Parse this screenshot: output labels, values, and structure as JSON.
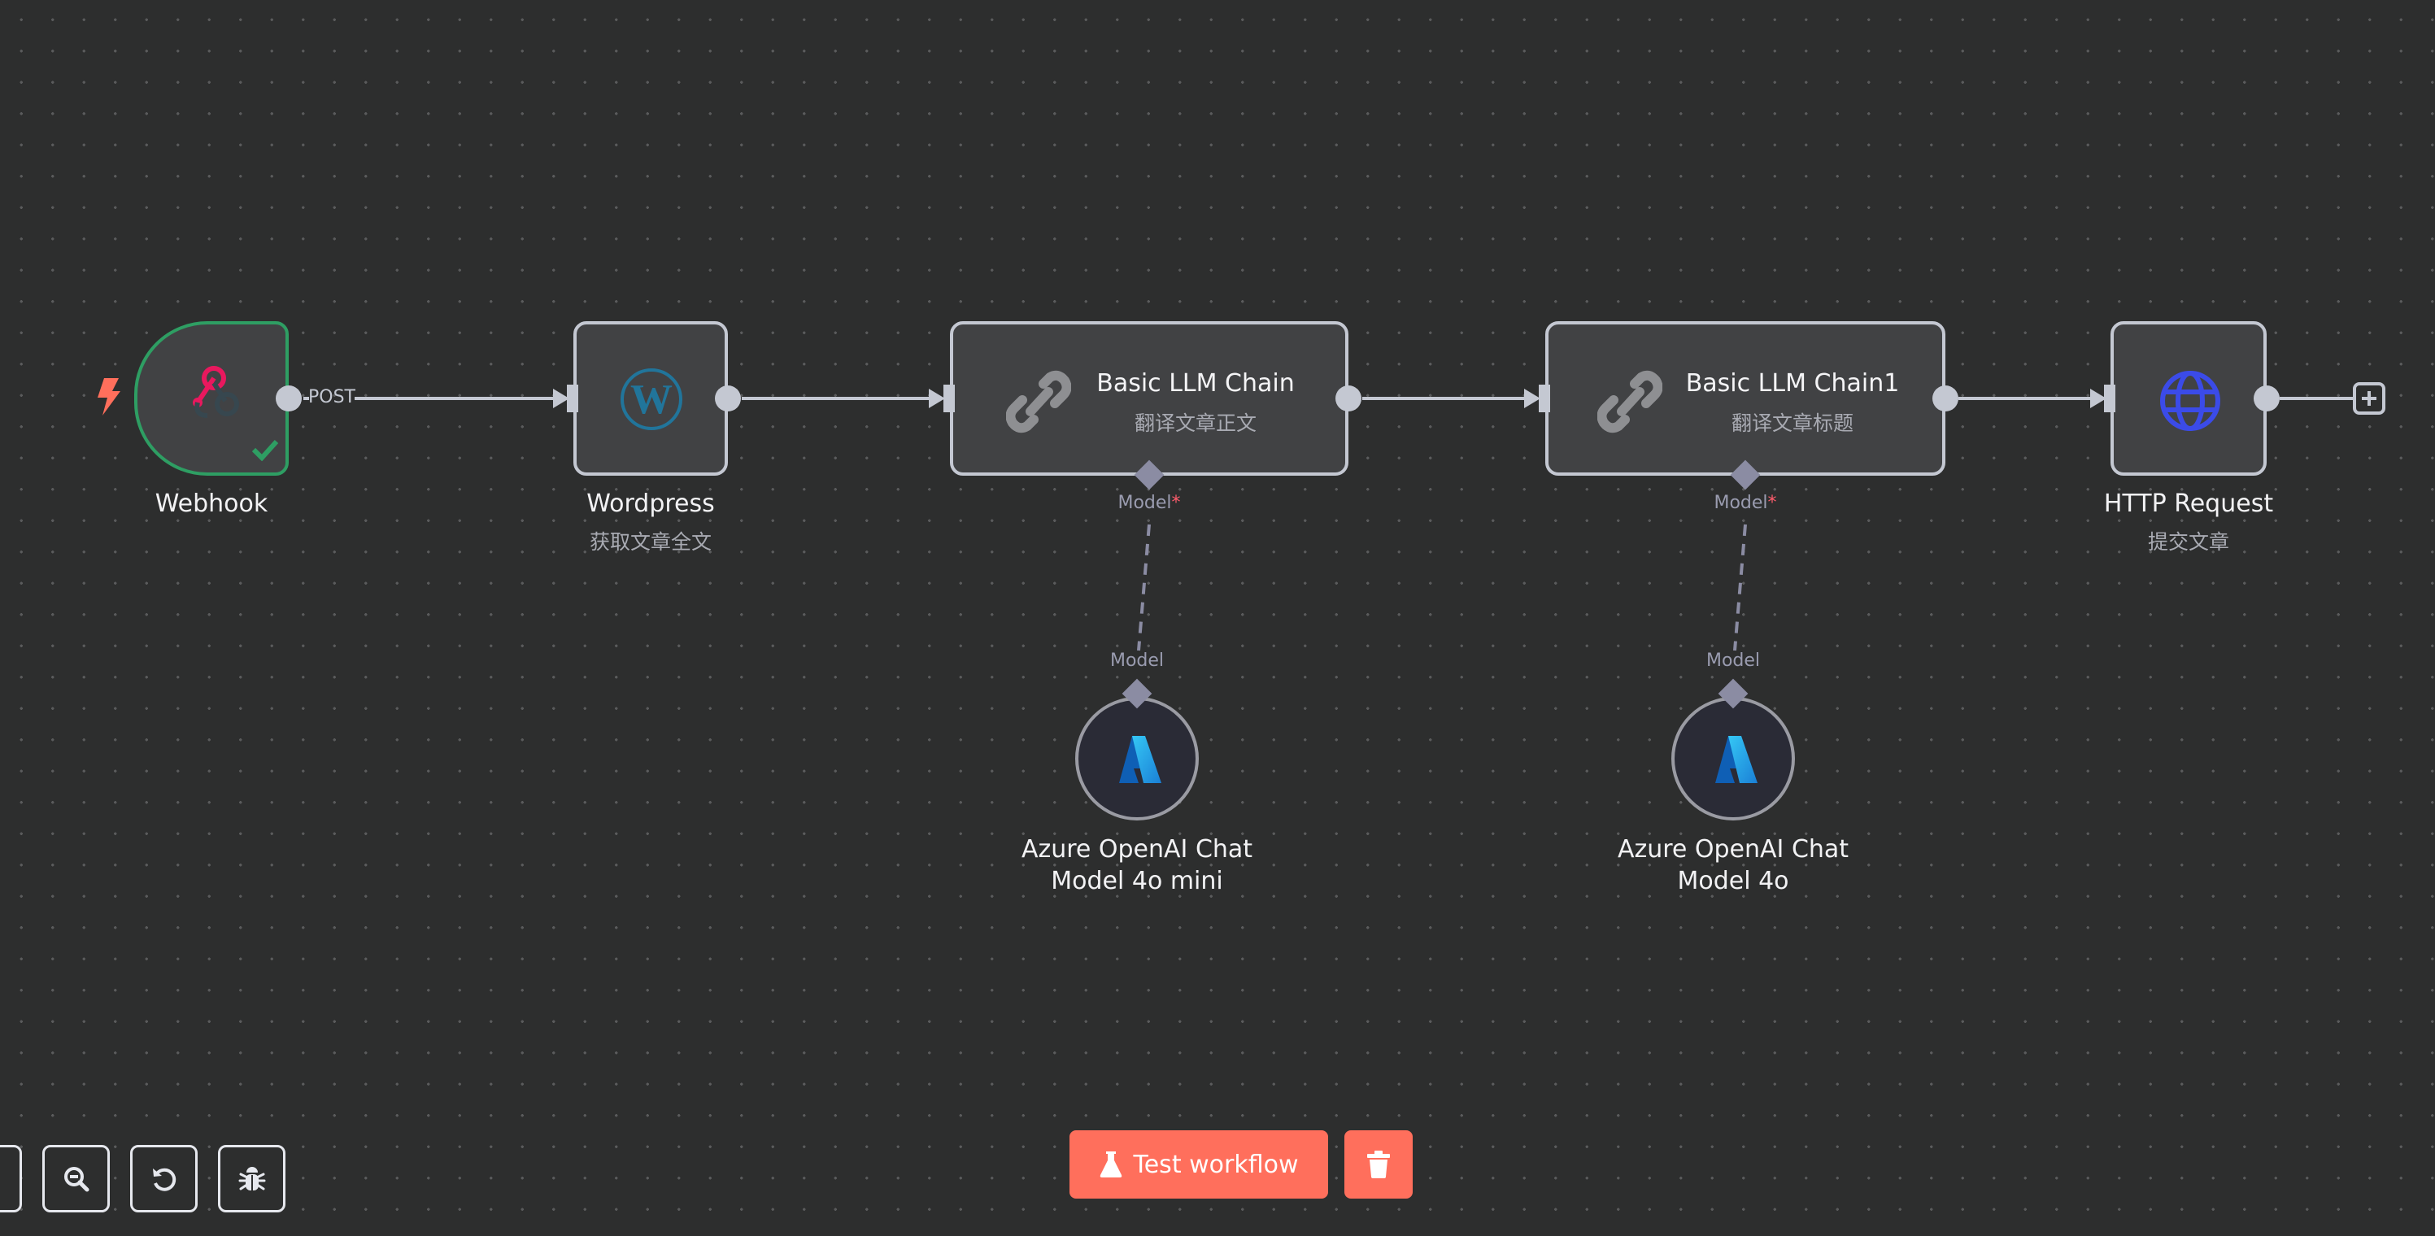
{
  "canvas": {
    "nodes": [
      {
        "id": "webhook",
        "title": "Webhook",
        "subtitle": "",
        "icon": "webhook-icon",
        "status": "success"
      },
      {
        "id": "wordpress",
        "title": "Wordpress",
        "subtitle": "获取文章全文",
        "icon": "wordpress-icon"
      },
      {
        "id": "llm1",
        "title": "Basic LLM Chain",
        "subtitle": "翻译文章正文",
        "icon": "link-icon"
      },
      {
        "id": "llm2",
        "title": "Basic LLM Chain1",
        "subtitle": "翻译文章标题",
        "icon": "link-icon"
      },
      {
        "id": "http",
        "title": "HTTP Request",
        "subtitle": "提交文章",
        "icon": "globe-icon"
      },
      {
        "id": "azure1",
        "title_line1": "Azure OpenAI Chat",
        "title_line2": "Model 4o mini",
        "icon": "azure-icon"
      },
      {
        "id": "azure2",
        "title_line1": "Azure OpenAI Chat",
        "title_line2": "Model 4o",
        "icon": "azure-icon"
      }
    ],
    "connections": [
      {
        "from": "webhook",
        "to": "wordpress",
        "label": "POST"
      },
      {
        "from": "wordpress",
        "to": "llm1",
        "label": ""
      },
      {
        "from": "llm1",
        "to": "llm2",
        "label": ""
      },
      {
        "from": "llm2",
        "to": "http",
        "label": ""
      },
      {
        "from": "azure1",
        "to": "llm1",
        "label": "Model"
      },
      {
        "from": "azure2",
        "to": "llm2",
        "label": "Model"
      }
    ],
    "handles": {
      "model_input_label": "Model",
      "model_required_mark": "*",
      "model_output_label": "Model"
    }
  },
  "toolbar": {
    "test_workflow_label": "Test workflow",
    "buttons": [
      "zoom-to-fit",
      "zoom-out",
      "reset-zoom",
      "debug"
    ]
  },
  "colors": {
    "accent": "#ff6f5c",
    "success": "#2e9e63",
    "trigger": "#ff6f5c",
    "node_border": "#c4c8d2",
    "canvas": "#2d2e2e"
  }
}
